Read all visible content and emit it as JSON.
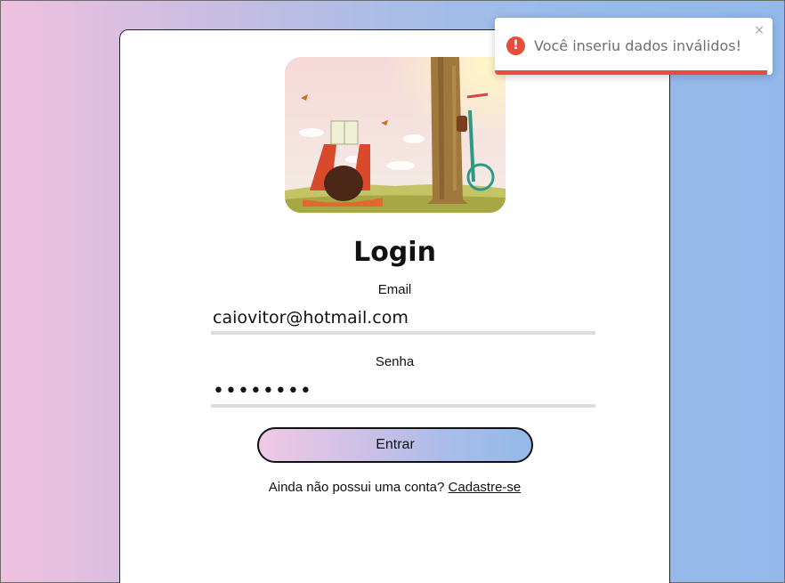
{
  "login": {
    "title": "Login",
    "email_label": "Email",
    "email_value": "caiovitor@hotmail.com",
    "password_label": "Senha",
    "password_value": "********",
    "submit_label": "Entrar",
    "signup_prompt": "Ainda não possui uma conta? ",
    "signup_link": "Cadastre-se"
  },
  "toast": {
    "icon": "exclamation-icon",
    "message": "Você inseriu dados inválidos!",
    "close": "×",
    "progress": 0.98,
    "color": "#e74c3c"
  },
  "colors": {
    "gradient_left": "#f0c0e0",
    "gradient_right": "#93b9ea"
  }
}
